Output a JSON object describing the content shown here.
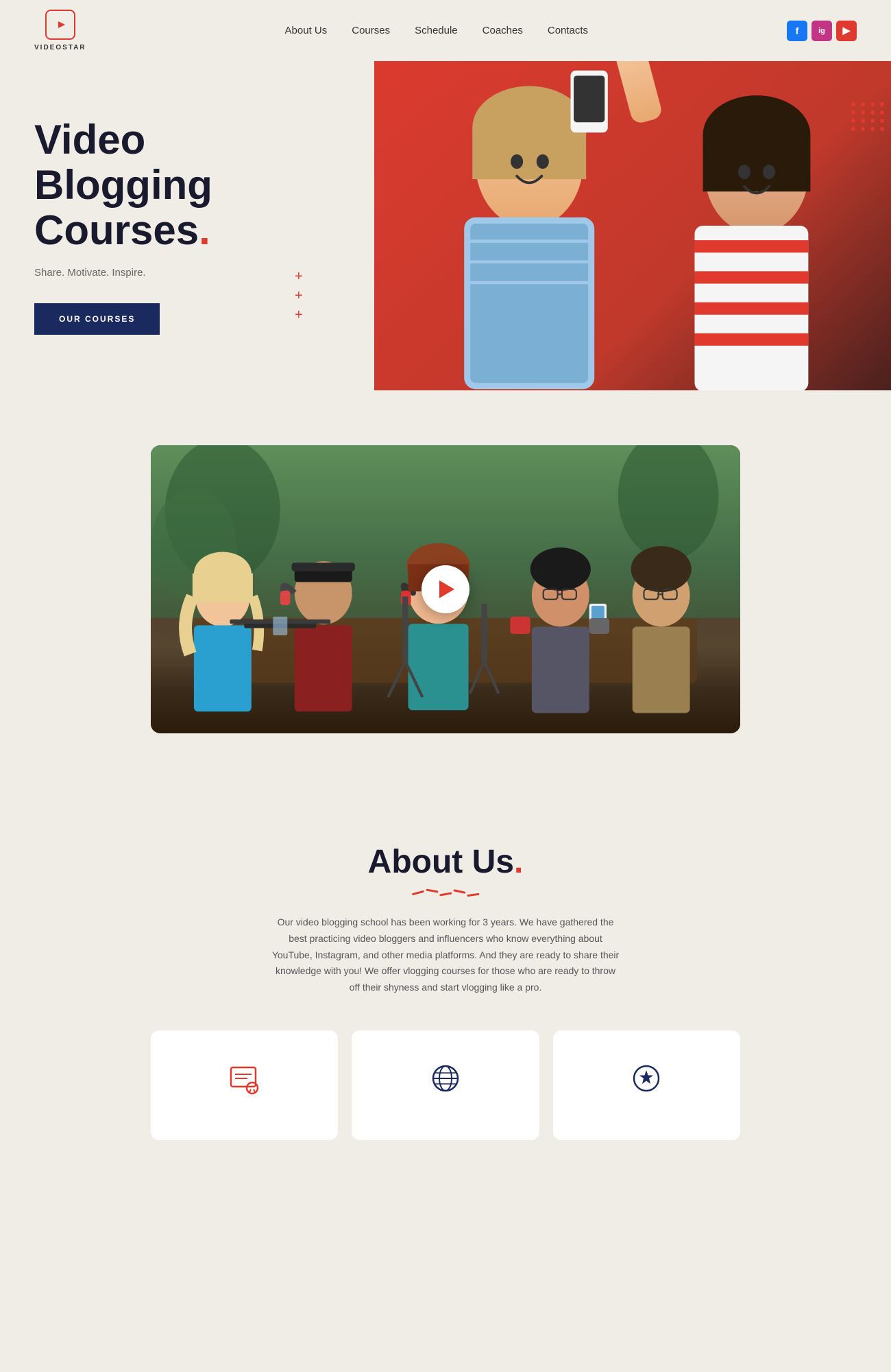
{
  "site": {
    "name": "VIDEOSTAR",
    "logo_alt": "VideoStar Logo"
  },
  "navbar": {
    "links": [
      {
        "label": "About Us",
        "href": "#about"
      },
      {
        "label": "Courses",
        "href": "#courses"
      },
      {
        "label": "Schedule",
        "href": "#schedule"
      },
      {
        "label": "Coaches",
        "href": "#coaches"
      },
      {
        "label": "Contacts",
        "href": "#contacts"
      }
    ],
    "social": [
      {
        "name": "facebook",
        "label": "f"
      },
      {
        "name": "instagram",
        "label": "ig"
      },
      {
        "name": "youtube",
        "label": "▶"
      }
    ]
  },
  "hero": {
    "title_line1": "Video Blogging",
    "title_line2": "Courses",
    "dot": ".",
    "subtitle": "Share. Motivate. Inspire.",
    "cta_button": "OUR COURSES"
  },
  "video_section": {
    "play_label": "Play Video"
  },
  "about": {
    "title": "About Us",
    "dot": ".",
    "description": "Our video blogging school has been working for 3 years. We have gathered the best practicing video bloggers and influencers who know everything about YouTube, Instagram, and other media platforms. And they are ready to share their knowledge with you! We offer vlogging courses for those who are ready to throw off their shyness and start vlogging like a pro."
  },
  "cards": [
    {
      "icon": "diploma-icon",
      "icon_char": "🎓"
    },
    {
      "icon": "globe-icon",
      "icon_char": "🌐"
    },
    {
      "icon": "star-icon",
      "icon_char": "⭐"
    }
  ],
  "colors": {
    "accent": "#e03a2f",
    "dark_navy": "#1a2a5e",
    "bg": "#f0ede6",
    "text_dark": "#1a1a2e",
    "text_muted": "#555"
  }
}
